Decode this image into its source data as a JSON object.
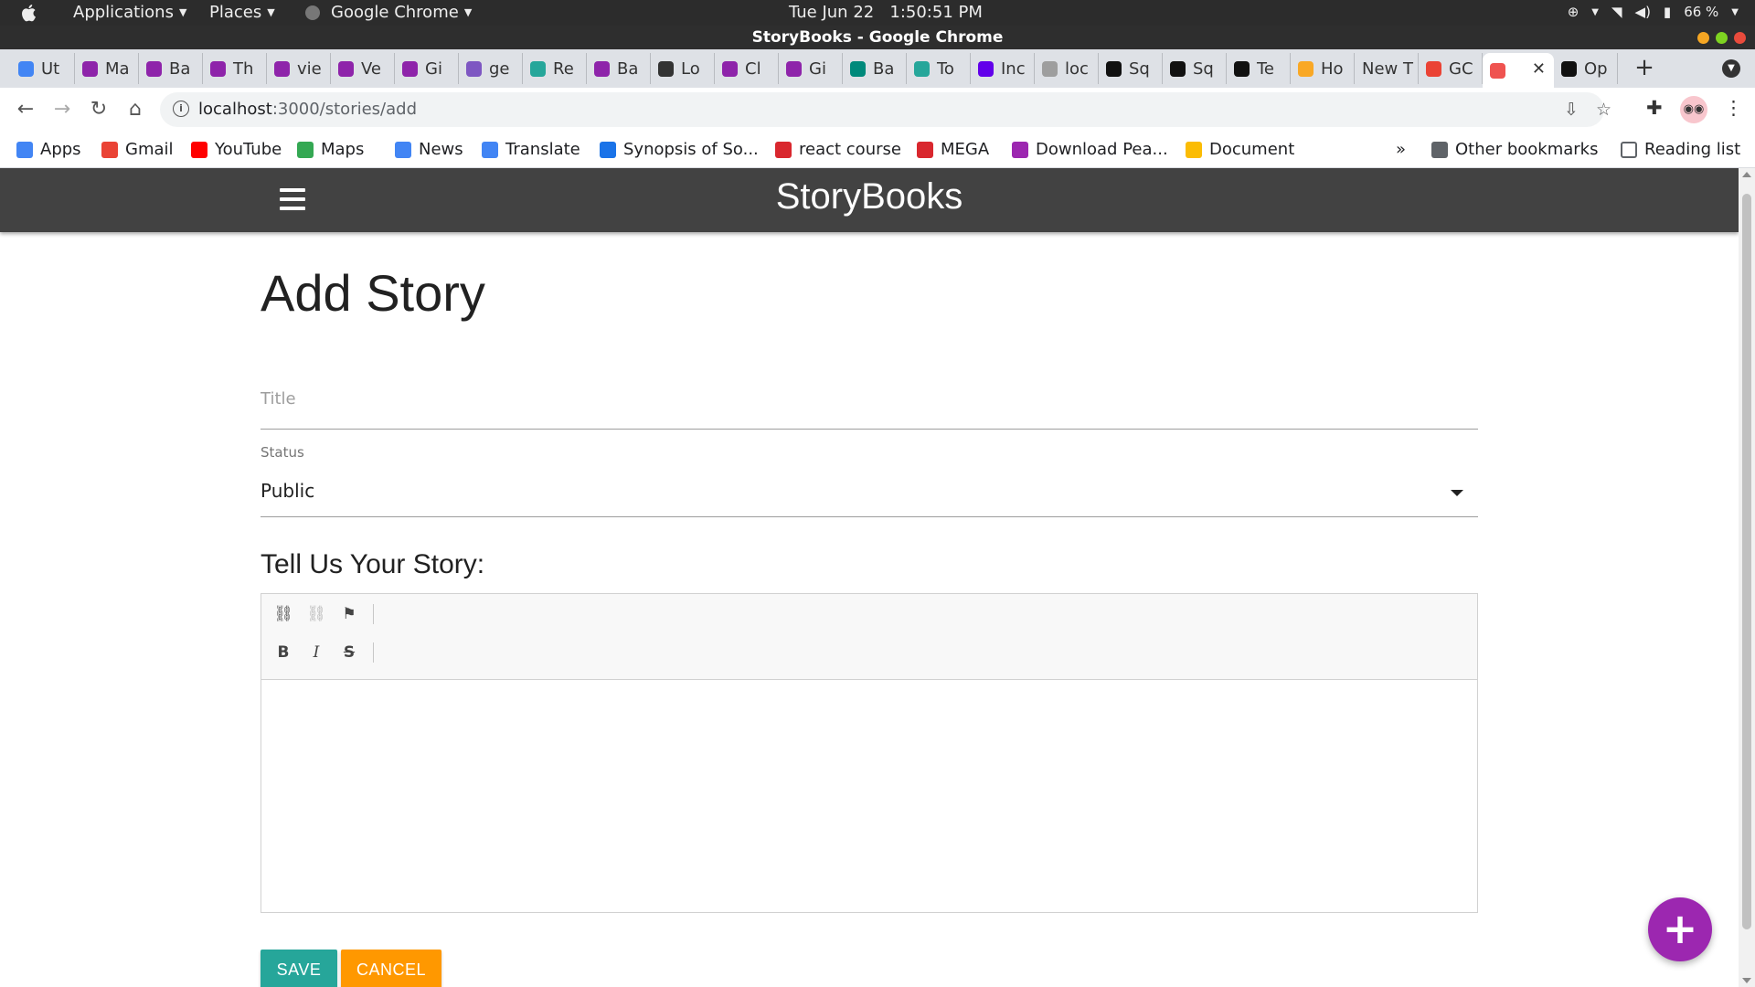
{
  "os_bar": {
    "applications_label": "Applications",
    "places_label": "Places",
    "chrome_label": "Google Chrome",
    "clock": "Tue Jun 22   1:50:51 PM",
    "battery": "66 %"
  },
  "window": {
    "title": "StoryBooks - Google Chrome"
  },
  "tabs": [
    {
      "label": "Ut",
      "icon": "refresh-icon",
      "color": "#4285f4"
    },
    {
      "label": "Ma",
      "icon": "d-icon",
      "color": "#8e24aa"
    },
    {
      "label": "Ba",
      "icon": "d-icon",
      "color": "#8e24aa"
    },
    {
      "label": "Th",
      "icon": "d-icon",
      "color": "#8e24aa"
    },
    {
      "label": "vie",
      "icon": "d-icon",
      "color": "#8e24aa"
    },
    {
      "label": "Ve",
      "icon": "d-icon",
      "color": "#8e24aa"
    },
    {
      "label": "Gi",
      "icon": "d-icon",
      "color": "#8e24aa"
    },
    {
      "label": "ge",
      "icon": "h-icon",
      "color": "#7e57c2"
    },
    {
      "label": "Re",
      "icon": "d-icon",
      "color": "#26a69a"
    },
    {
      "label": "Ba",
      "icon": "d-icon",
      "color": "#8e24aa"
    },
    {
      "label": "Lo",
      "icon": "l-icon",
      "color": "#333333"
    },
    {
      "label": "Cl",
      "icon": "d-icon",
      "color": "#8e24aa"
    },
    {
      "label": "Gi",
      "icon": "d-icon",
      "color": "#8e24aa"
    },
    {
      "label": "Ba",
      "icon": "hex-icon",
      "color": "#00897b"
    },
    {
      "label": "To",
      "icon": "hex-icon",
      "color": "#26a69a"
    },
    {
      "label": "Inc",
      "icon": "clock-icon",
      "color": "#6200ea"
    },
    {
      "label": "loc",
      "icon": "globe-icon",
      "color": "#9e9e9e"
    },
    {
      "label": "Sq",
      "icon": "square-icon",
      "color": "#111111"
    },
    {
      "label": "Sq",
      "icon": "square-icon",
      "color": "#111111"
    },
    {
      "label": "Te",
      "icon": "square-icon",
      "color": "#111111"
    },
    {
      "label": "Ho",
      "icon": "face-icon",
      "color": "#f9a825"
    },
    {
      "label": "New T",
      "icon": "none",
      "color": "#dee1e6"
    },
    {
      "label": "GC",
      "icon": "pinwheel-icon",
      "color": "#ea4335"
    },
    {
      "label": "",
      "icon": "book-icon",
      "color": "#ef5350",
      "active": true
    },
    {
      "label": "Op",
      "icon": "github-icon",
      "color": "#111111"
    }
  ],
  "toolbar": {
    "url_host": "localhost",
    "url_path": ":3000/stories/add"
  },
  "bookmarks": {
    "items": [
      {
        "label": "Apps",
        "icon": "apps-grid-icon",
        "color": "#4285f4"
      },
      {
        "label": "Gmail",
        "icon": "gmail-icon",
        "color": "#ea4335"
      },
      {
        "label": "YouTube",
        "icon": "youtube-icon",
        "color": "#ff0000"
      },
      {
        "label": "Maps",
        "icon": "maps-pin-icon",
        "color": "#34a853"
      },
      {
        "label": "News",
        "icon": "news-icon",
        "color": "#4285f4"
      },
      {
        "label": "Translate",
        "icon": "translate-icon",
        "color": "#4285f4"
      },
      {
        "label": "Synopsis of So...",
        "icon": "f-icon",
        "color": "#1a73e8"
      },
      {
        "label": "react course",
        "icon": "mega-icon",
        "color": "#d9272e"
      },
      {
        "label": "MEGA",
        "icon": "mega-icon",
        "color": "#d9272e"
      },
      {
        "label": "Download Pea...",
        "icon": "m-icon",
        "color": "#9c27b0"
      },
      {
        "label": "Document",
        "icon": "doc-icon",
        "color": "#fbbc04"
      }
    ],
    "overflow": "»",
    "other": "Other bookmarks",
    "reading": "Reading list"
  },
  "app": {
    "brand": "StoryBooks",
    "nav_color": "#424242"
  },
  "form": {
    "heading": "Add Story",
    "title_placeholder": "Title",
    "status_label": "Status",
    "status_value": "Public",
    "story_label": "Tell Us Your Story:",
    "save_label": "SAVE",
    "cancel_label": "CANCEL",
    "save_color": "#26a69a",
    "cancel_color": "#ff9800"
  },
  "fab": {
    "label": "+",
    "color": "#9c27b0"
  }
}
